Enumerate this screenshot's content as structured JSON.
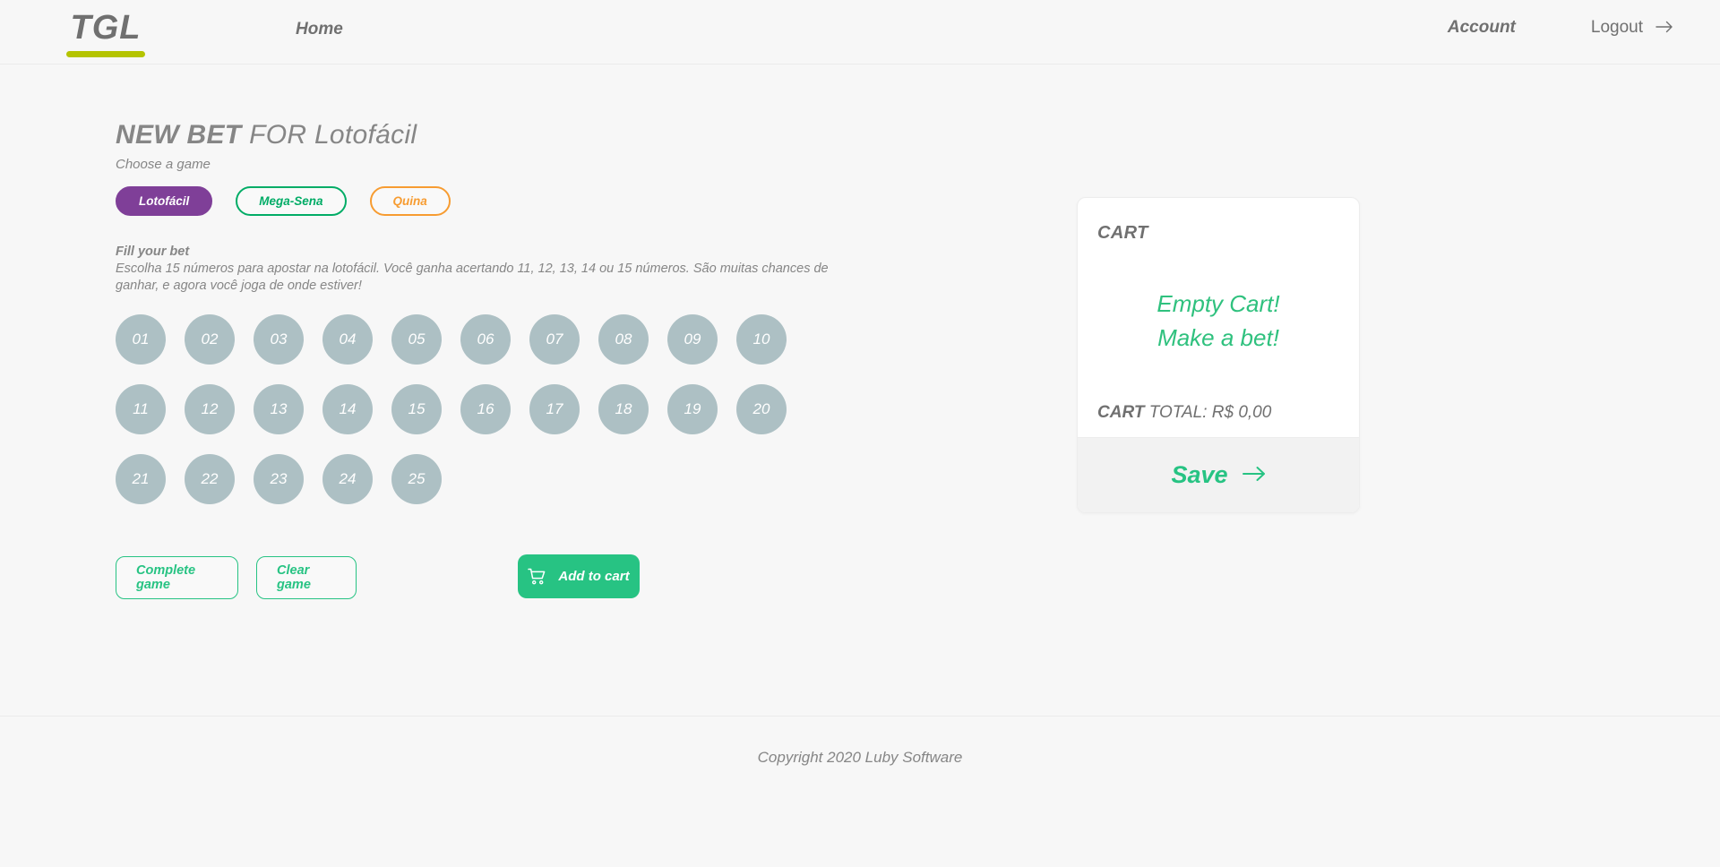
{
  "header": {
    "logo": "TGL",
    "nav_home": "Home",
    "nav_account": "Account",
    "nav_logout": "Logout",
    "logout_icon": "arrow-right-icon",
    "logo_underline_color": "#B5C401"
  },
  "main": {
    "title_bold": "NEW BET",
    "title_for": " FOR ",
    "title_game": "Lotofácil",
    "subtitle": "Choose a game",
    "games": [
      {
        "label": "Lotofácil",
        "color": "#7F3F98",
        "selected": true
      },
      {
        "label": "Mega-Sena",
        "color": "#01AC66",
        "selected": false
      },
      {
        "label": "Quina",
        "color": "#F79C31",
        "selected": false
      }
    ],
    "fill_heading": "Fill your bet",
    "fill_description": "Escolha 15 números para apostar na lotofácil. Você ganha acertando 11, 12, 13, 14 ou 15 números. São muitas chances de ganhar, e agora você joga de onde estiver!",
    "numbers": [
      "01",
      "02",
      "03",
      "04",
      "05",
      "06",
      "07",
      "08",
      "09",
      "10",
      "11",
      "12",
      "13",
      "14",
      "15",
      "16",
      "17",
      "18",
      "19",
      "20",
      "21",
      "22",
      "23",
      "24",
      "25"
    ],
    "ball_color": "#ADC0C4",
    "buttons": {
      "complete_game": "Complete game",
      "clear_game": "Clear game",
      "add_to_cart": "Add to cart",
      "add_to_cart_icon": "shopping-cart-icon",
      "accent_color": "#27C383"
    }
  },
  "cart": {
    "title": "CART",
    "empty_line1": "Empty Cart!",
    "empty_line2": "Make a bet!",
    "total_bold": "CART",
    "total_rest": " TOTAL: R$ 0,00",
    "save_label": "Save",
    "save_icon": "arrow-right-icon",
    "empty_color": "#2FC17E"
  },
  "footer": {
    "copyright": "Copyright 2020 Luby Software"
  }
}
